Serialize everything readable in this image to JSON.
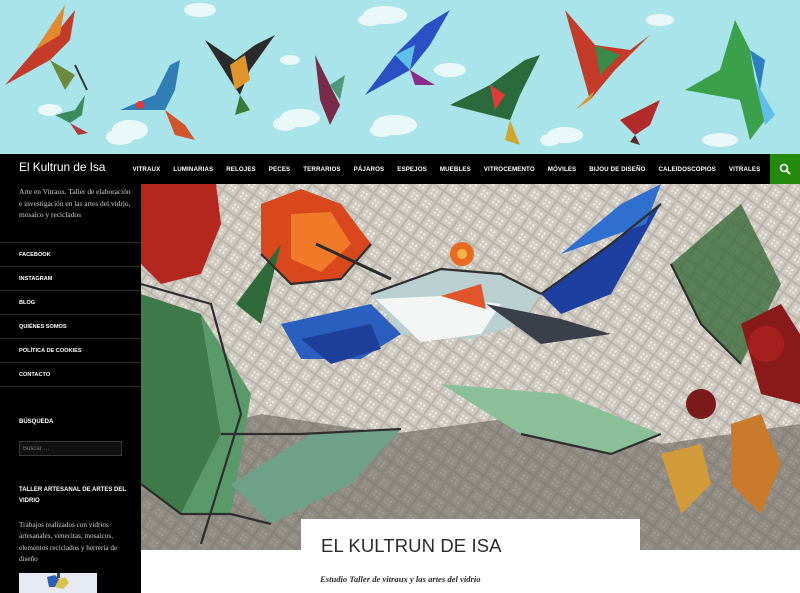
{
  "site": {
    "title": "El Kultrun de Isa",
    "tagline": "Arte en Vitraux. Taller de elaboración e investigación en las artes del vidrio, mosaico y reciclados"
  },
  "nav": {
    "items": [
      "Vitraux",
      "Luminarias",
      "Relojes",
      "Peces",
      "Terrarios",
      "Pájaros",
      "Espejos",
      "Muebles",
      "Vitrocemento",
      "Móviles",
      "Bijou de diseño",
      "Caleidoscopios",
      "Vitrales"
    ],
    "search_icon": "search-icon",
    "accent": "#24890d"
  },
  "sidebar": {
    "menu": [
      "Facebook",
      "Instagram",
      "Blog",
      "Quiénes somos",
      "Política de cookies",
      "Contacto"
    ],
    "search_widget": {
      "title": "Búsqueda",
      "placeholder": "Buscar …"
    },
    "artisan_widget": {
      "title": "Taller artesanal de artes del vidrio",
      "text": "Trabajos realizados con vidrios artesanales, venecitas, mosaicos, elementos reciclados y herrería de diseño"
    }
  },
  "post": {
    "title": "El Kultrun de Isa",
    "subtitle": "Estudio Taller de vitraux y las artes del vidrio"
  },
  "colors": {
    "banner_sky": "#a9e4ea",
    "background": "#000000",
    "content": "#ffffff"
  }
}
